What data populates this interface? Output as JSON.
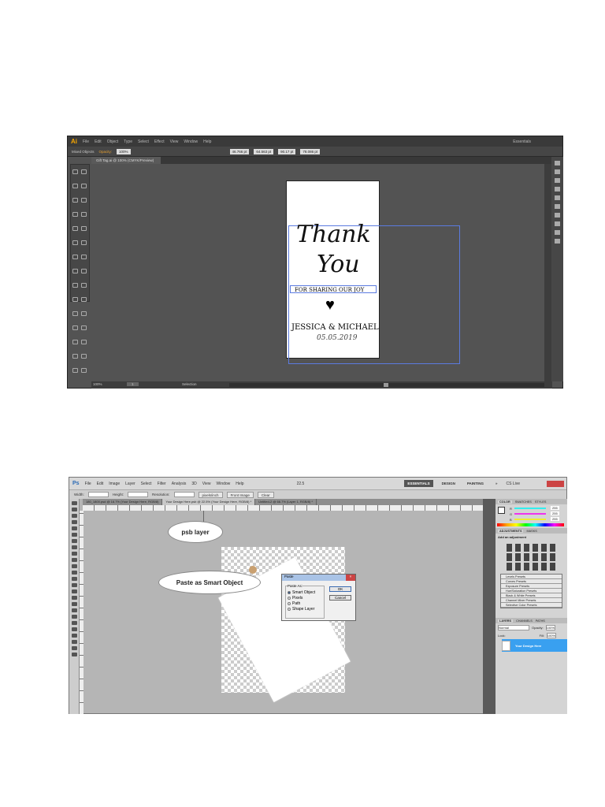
{
  "illustrator": {
    "app_logo": "Ai",
    "menu": [
      "File",
      "Edit",
      "Object",
      "Type",
      "Select",
      "Effect",
      "View",
      "Window",
      "Help"
    ],
    "workspace": "Essentials",
    "control": {
      "label": "Mixed Objects",
      "opacity_label": "Opacity:",
      "opacity": "100%",
      "x": "46.766 pt",
      "y": "64.563 pt",
      "w": "90.17 pt",
      "h": "78.086 pt"
    },
    "doc_tab": "Gift Tag.ai @ 100% (CMYK/Preview)",
    "artboard": {
      "line1": "Thank",
      "line2": "You",
      "line3": "FOR SHARING OUR JOY",
      "heart": "♥",
      "names": "JESSICA & MICHAEL",
      "date": "05.05.2019"
    },
    "status": {
      "zoom": "100%",
      "page": "1",
      "tool": "Selection"
    }
  },
  "photoshop": {
    "app_logo": "Ps",
    "menu": [
      "File",
      "Edit",
      "Image",
      "Layer",
      "Select",
      "Filter",
      "Analysis",
      "3D",
      "View",
      "Window",
      "Help"
    ],
    "zoom": "22.5",
    "workspaces": [
      "ESSENTIALS",
      "DESIGN",
      "PAINTING",
      "»"
    ],
    "cslive": "CS Live",
    "options": {
      "width_label": "Width:",
      "height_label": "Height:",
      "resolution_label": "Resolution:",
      "units": "pixels/inch",
      "front_image": "Front Image",
      "clear": "Clear"
    },
    "tabs": [
      "180_1800.psd @ 16.7% (Your Design Here, RGB/8)",
      "Your Design Here.psb @ 22.5% (Your Design Here, RGB/8) *",
      "Untitled-2 @ 66.7% (Layer 1, RGB/8) *"
    ],
    "callouts": {
      "psb": "psb layer",
      "paste": "Paste as Smart Object"
    },
    "dialog": {
      "title": "Paste",
      "group": "Paste As:",
      "options": [
        "Smart Object",
        "Pixels",
        "Path",
        "Shape Layer"
      ],
      "ok": "OK",
      "cancel": "Cancel"
    },
    "panels": {
      "color_tabs": [
        "COLOR",
        "SWATCHES",
        "STYLES"
      ],
      "rgb": [
        {
          "label": "R",
          "value": "255"
        },
        {
          "label": "G",
          "value": "255"
        },
        {
          "label": "B",
          "value": "255"
        }
      ],
      "adj_tabs": [
        "ADJUSTMENTS",
        "MASKS"
      ],
      "adj_title": "Add an adjustment",
      "presets": [
        "Levels Presets",
        "Curves Presets",
        "Exposure Presets",
        "Hue/Saturation Presets",
        "Black & White Presets",
        "Channel Mixer Presets",
        "Selective Color Presets"
      ],
      "layer_tabs": [
        "LAYERS",
        "CHANNELS",
        "PATHS"
      ],
      "blend": "Normal",
      "opacity_label": "Opacity:",
      "opacity": "100%",
      "lock_label": "Lock:",
      "fill_label": "Fill:",
      "fill": "100%",
      "layer_name": "Your Design Here"
    }
  }
}
